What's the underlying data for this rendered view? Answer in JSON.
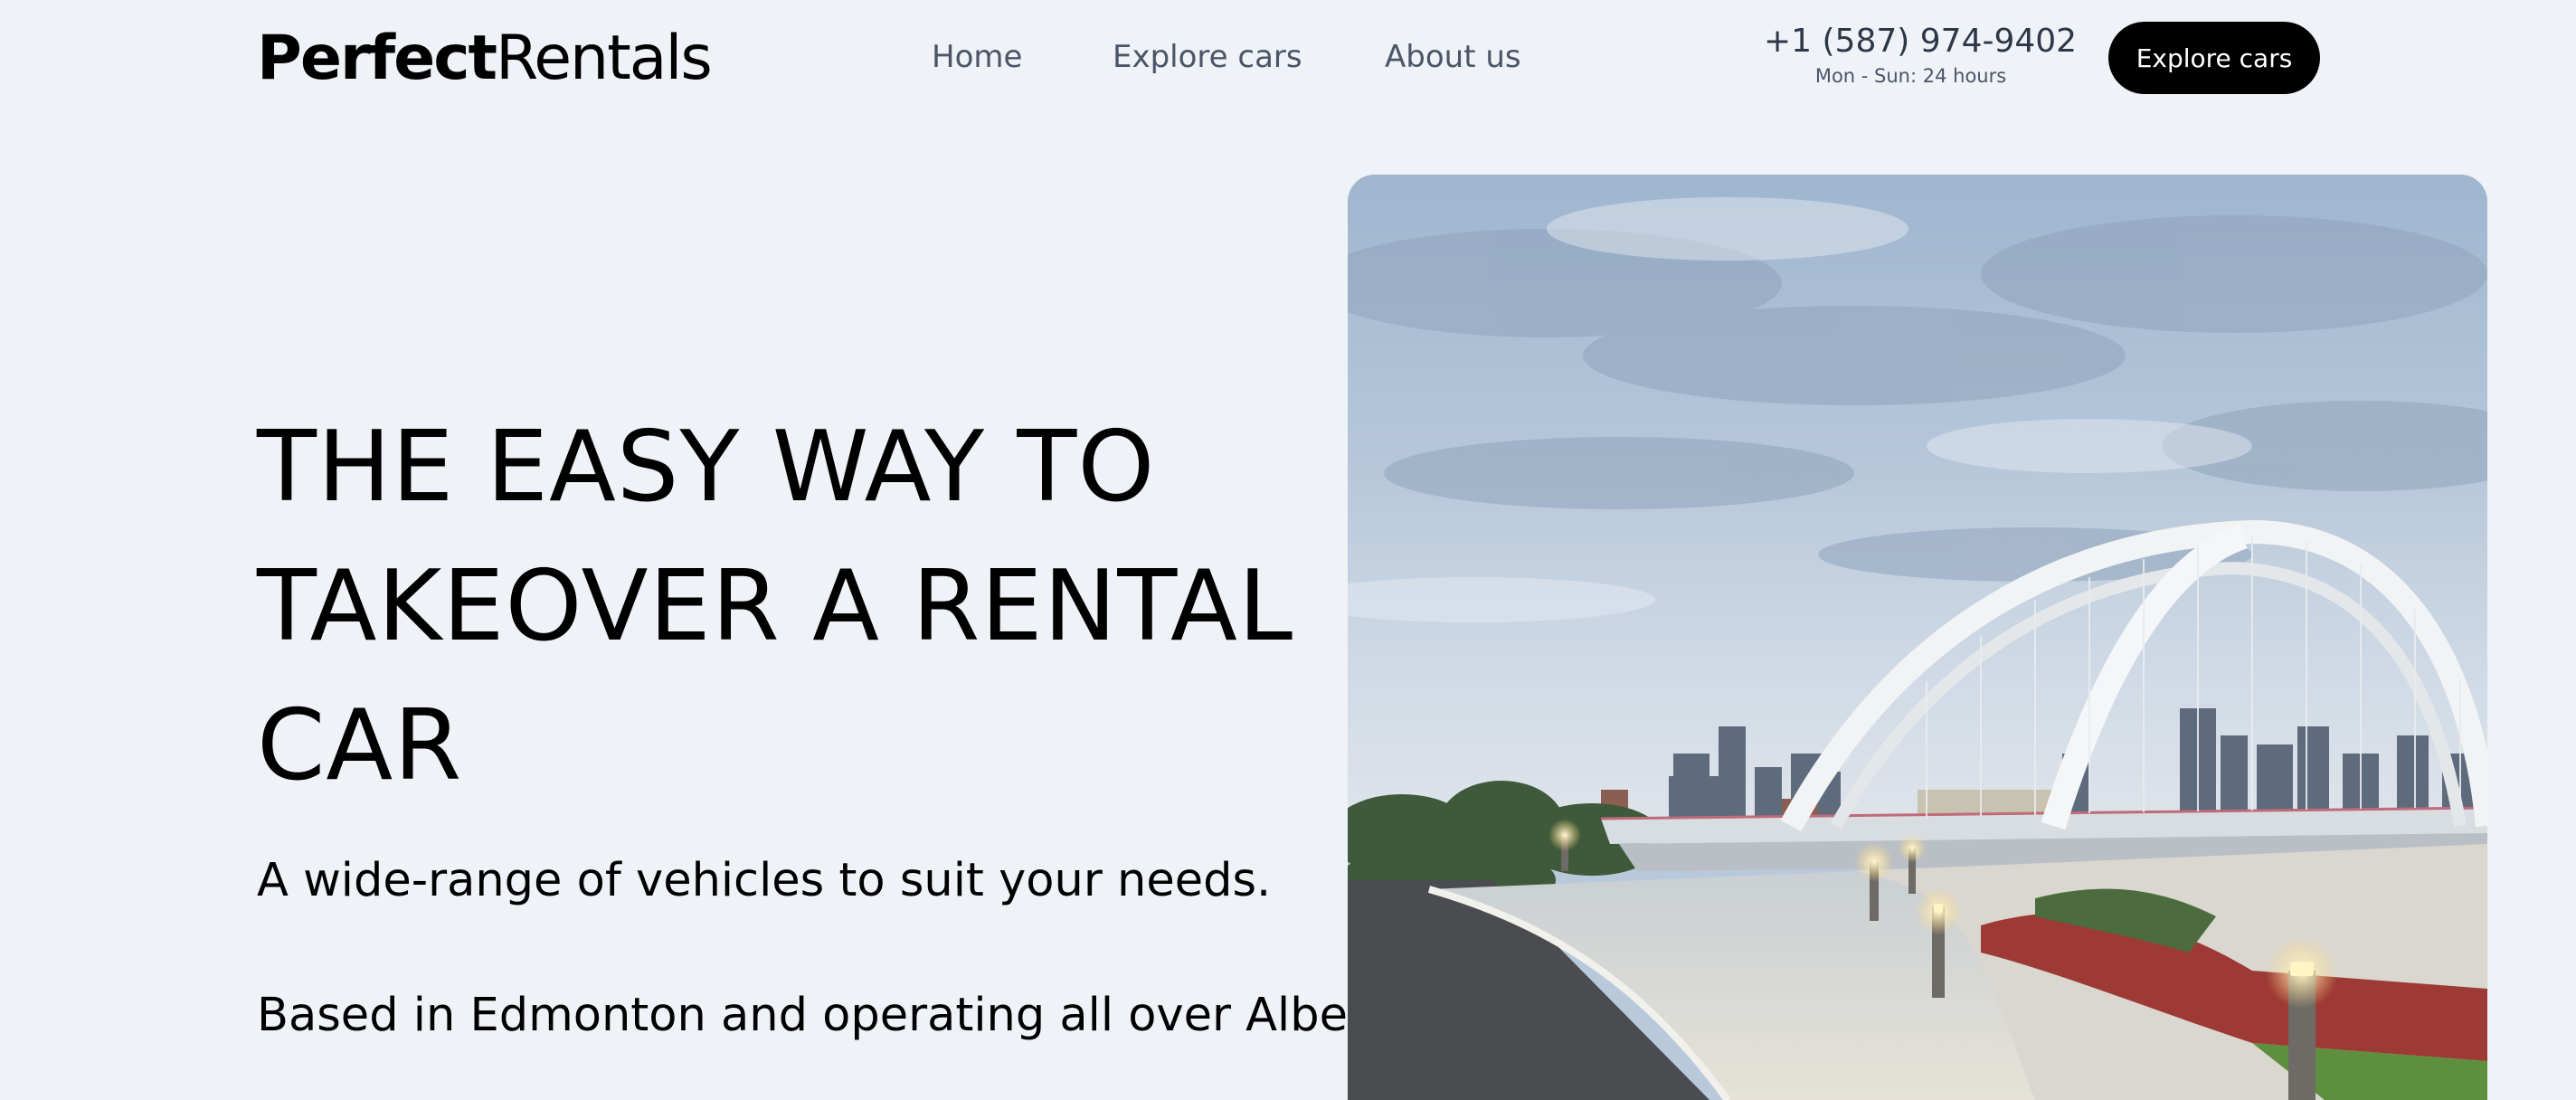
{
  "header": {
    "logo": {
      "part1": "Perfect",
      "part2": "Rentals"
    },
    "nav": [
      {
        "label": "Home"
      },
      {
        "label": "Explore cars"
      },
      {
        "label": "About us"
      }
    ],
    "phone": "+1 (587) 974-9402",
    "hours": "Mon - Sun: 24 hours",
    "cta_label": "Explore cars"
  },
  "hero": {
    "title_lines": [
      "THE EASY WAY TO",
      "TAKEOVER A RENTAL",
      "CAR"
    ],
    "subtitle_1": "A wide-range of vehicles to suit your needs.",
    "subtitle_2": "Based in Edmonton and operating all over Alberta!",
    "image_subject": "arch-bridge-city-skyline-photo"
  },
  "colors": {
    "background": "#eff2f7",
    "nav_text": "#4a5568",
    "cta_background": "#000000",
    "cta_text": "#ffffff"
  }
}
